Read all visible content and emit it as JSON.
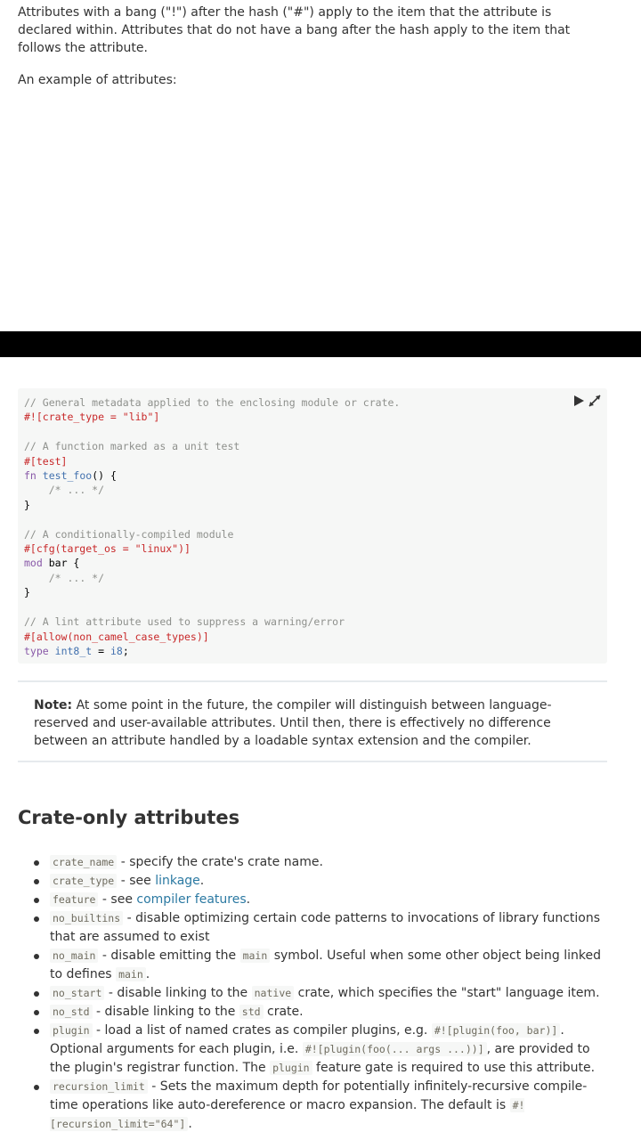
{
  "intro": {
    "para1": "Attributes with a bang (\"!\") after the hash (\"#\") apply to the item that the attribute is declared within. Attributes that do not have a bang after the hash apply to the item that follows the attribute.",
    "para2": "An example of attributes:"
  },
  "code": {
    "c1": "// General metadata applied to the enclosing module or crate.",
    "l1": "#![crate_type = \"lib\"]",
    "c2": "// A function marked as a unit test",
    "l2": "#[test]",
    "l3_kw": "fn",
    "l3_name": "test_foo",
    "l3_rest": "() {",
    "l4": "/* ... */",
    "l5": "}",
    "c3": "// A conditionally-compiled module",
    "l6": "#[cfg(target_os = \"linux\")]",
    "l7_kw": "mod",
    "l7_rest": "bar {",
    "l8": "/* ... */",
    "l9": "}",
    "c4": "// A lint attribute used to suppress a warning/error",
    "l10": "#[allow(non_camel_case_types)]",
    "l11_kw": "type",
    "l11_name": "int8_t",
    "l11_eq": "=",
    "l11_type": "i8",
    "l11_end": ";",
    "play_icon": "play-icon",
    "expand_icon": "expand-icon"
  },
  "note": {
    "label": "Note:",
    "text": "At some point in the future, the compiler will distinguish between language-reserved and user-available attributes. Until then, there is effectively no difference between an attribute handled by a loadable syntax extension and the compiler."
  },
  "section": {
    "title": "Crate-only attributes"
  },
  "attrs": [
    {
      "code": "crate_name",
      "text": " - specify the crate's crate name."
    },
    {
      "code": "crate_type",
      "text": " - see ",
      "link": "linkage",
      "after": "."
    },
    {
      "code": "feature",
      "text": " - see ",
      "link": "compiler features",
      "after": "."
    },
    {
      "code": "no_builtins",
      "text": " - disable optimizing certain code patterns to invocations of library functions that are assumed to exist"
    },
    {
      "code": "no_main",
      "text1": " - disable emitting the ",
      "code2": "main",
      "text2": " symbol. Useful when some other object being linked to defines ",
      "code3": "main",
      "text3": "."
    },
    {
      "code": "no_start",
      "text1": " - disable linking to the ",
      "code2": "native",
      "text2": " crate, which specifies the \"start\" language item."
    },
    {
      "code": "no_std",
      "text1": " - disable linking to the ",
      "code2": "std",
      "text2": " crate."
    },
    {
      "code": "plugin",
      "text1": " - load a list of named crates as compiler plugins, e.g. ",
      "code2": "#![plugin(foo, bar)]",
      "text2": ". Optional arguments for each plugin, i.e. ",
      "code3": "#![plugin(foo(... args ...))]",
      "text3": ", are provided to the plugin's registrar function. The ",
      "code4": "plugin",
      "text4": " feature gate is required to use this attribute."
    },
    {
      "code": "recursion_limit",
      "text1": " - Sets the maximum depth for potentially infinitely-recursive compile-time operations like auto-dereference or macro expansion. The default is ",
      "code2": "#![recursion_limit=\"64\"]",
      "text2": "."
    }
  ]
}
